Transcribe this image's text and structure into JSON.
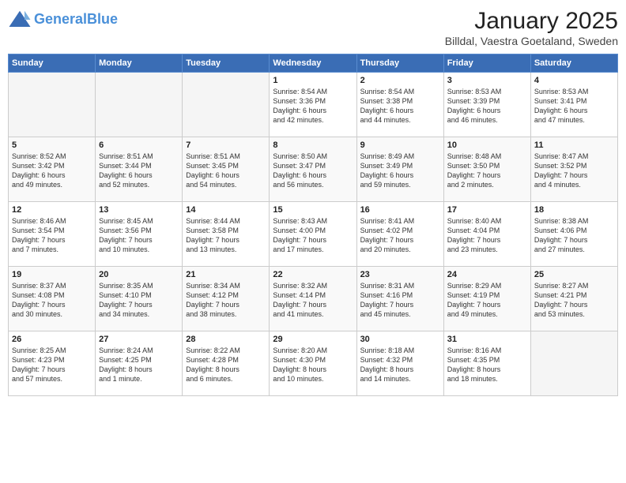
{
  "header": {
    "logo_line1": "General",
    "logo_line2": "Blue",
    "title": "January 2025",
    "subtitle": "Billdal, Vaestra Goetaland, Sweden"
  },
  "days_of_week": [
    "Sunday",
    "Monday",
    "Tuesday",
    "Wednesday",
    "Thursday",
    "Friday",
    "Saturday"
  ],
  "weeks": [
    [
      {
        "day": "",
        "info": ""
      },
      {
        "day": "",
        "info": ""
      },
      {
        "day": "",
        "info": ""
      },
      {
        "day": "1",
        "info": "Sunrise: 8:54 AM\nSunset: 3:36 PM\nDaylight: 6 hours\nand 42 minutes."
      },
      {
        "day": "2",
        "info": "Sunrise: 8:54 AM\nSunset: 3:38 PM\nDaylight: 6 hours\nand 44 minutes."
      },
      {
        "day": "3",
        "info": "Sunrise: 8:53 AM\nSunset: 3:39 PM\nDaylight: 6 hours\nand 46 minutes."
      },
      {
        "day": "4",
        "info": "Sunrise: 8:53 AM\nSunset: 3:41 PM\nDaylight: 6 hours\nand 47 minutes."
      }
    ],
    [
      {
        "day": "5",
        "info": "Sunrise: 8:52 AM\nSunset: 3:42 PM\nDaylight: 6 hours\nand 49 minutes."
      },
      {
        "day": "6",
        "info": "Sunrise: 8:51 AM\nSunset: 3:44 PM\nDaylight: 6 hours\nand 52 minutes."
      },
      {
        "day": "7",
        "info": "Sunrise: 8:51 AM\nSunset: 3:45 PM\nDaylight: 6 hours\nand 54 minutes."
      },
      {
        "day": "8",
        "info": "Sunrise: 8:50 AM\nSunset: 3:47 PM\nDaylight: 6 hours\nand 56 minutes."
      },
      {
        "day": "9",
        "info": "Sunrise: 8:49 AM\nSunset: 3:49 PM\nDaylight: 6 hours\nand 59 minutes."
      },
      {
        "day": "10",
        "info": "Sunrise: 8:48 AM\nSunset: 3:50 PM\nDaylight: 7 hours\nand 2 minutes."
      },
      {
        "day": "11",
        "info": "Sunrise: 8:47 AM\nSunset: 3:52 PM\nDaylight: 7 hours\nand 4 minutes."
      }
    ],
    [
      {
        "day": "12",
        "info": "Sunrise: 8:46 AM\nSunset: 3:54 PM\nDaylight: 7 hours\nand 7 minutes."
      },
      {
        "day": "13",
        "info": "Sunrise: 8:45 AM\nSunset: 3:56 PM\nDaylight: 7 hours\nand 10 minutes."
      },
      {
        "day": "14",
        "info": "Sunrise: 8:44 AM\nSunset: 3:58 PM\nDaylight: 7 hours\nand 13 minutes."
      },
      {
        "day": "15",
        "info": "Sunrise: 8:43 AM\nSunset: 4:00 PM\nDaylight: 7 hours\nand 17 minutes."
      },
      {
        "day": "16",
        "info": "Sunrise: 8:41 AM\nSunset: 4:02 PM\nDaylight: 7 hours\nand 20 minutes."
      },
      {
        "day": "17",
        "info": "Sunrise: 8:40 AM\nSunset: 4:04 PM\nDaylight: 7 hours\nand 23 minutes."
      },
      {
        "day": "18",
        "info": "Sunrise: 8:38 AM\nSunset: 4:06 PM\nDaylight: 7 hours\nand 27 minutes."
      }
    ],
    [
      {
        "day": "19",
        "info": "Sunrise: 8:37 AM\nSunset: 4:08 PM\nDaylight: 7 hours\nand 30 minutes."
      },
      {
        "day": "20",
        "info": "Sunrise: 8:35 AM\nSunset: 4:10 PM\nDaylight: 7 hours\nand 34 minutes."
      },
      {
        "day": "21",
        "info": "Sunrise: 8:34 AM\nSunset: 4:12 PM\nDaylight: 7 hours\nand 38 minutes."
      },
      {
        "day": "22",
        "info": "Sunrise: 8:32 AM\nSunset: 4:14 PM\nDaylight: 7 hours\nand 41 minutes."
      },
      {
        "day": "23",
        "info": "Sunrise: 8:31 AM\nSunset: 4:16 PM\nDaylight: 7 hours\nand 45 minutes."
      },
      {
        "day": "24",
        "info": "Sunrise: 8:29 AM\nSunset: 4:19 PM\nDaylight: 7 hours\nand 49 minutes."
      },
      {
        "day": "25",
        "info": "Sunrise: 8:27 AM\nSunset: 4:21 PM\nDaylight: 7 hours\nand 53 minutes."
      }
    ],
    [
      {
        "day": "26",
        "info": "Sunrise: 8:25 AM\nSunset: 4:23 PM\nDaylight: 7 hours\nand 57 minutes."
      },
      {
        "day": "27",
        "info": "Sunrise: 8:24 AM\nSunset: 4:25 PM\nDaylight: 8 hours\nand 1 minute."
      },
      {
        "day": "28",
        "info": "Sunrise: 8:22 AM\nSunset: 4:28 PM\nDaylight: 8 hours\nand 6 minutes."
      },
      {
        "day": "29",
        "info": "Sunrise: 8:20 AM\nSunset: 4:30 PM\nDaylight: 8 hours\nand 10 minutes."
      },
      {
        "day": "30",
        "info": "Sunrise: 8:18 AM\nSunset: 4:32 PM\nDaylight: 8 hours\nand 14 minutes."
      },
      {
        "day": "31",
        "info": "Sunrise: 8:16 AM\nSunset: 4:35 PM\nDaylight: 8 hours\nand 18 minutes."
      },
      {
        "day": "",
        "info": ""
      }
    ]
  ]
}
